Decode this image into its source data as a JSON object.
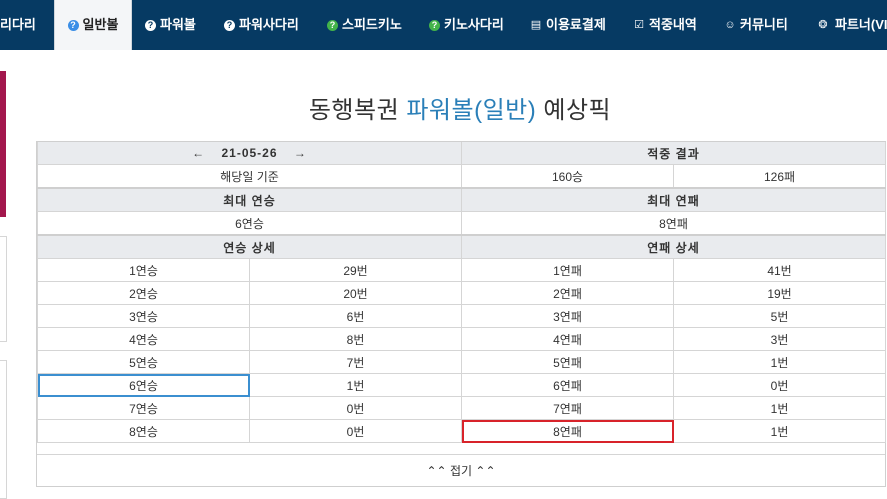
{
  "nav": {
    "items": [
      {
        "label": "리다리",
        "icon": ""
      },
      {
        "label": "일반볼",
        "icon": "question-circle-icon",
        "active": true
      },
      {
        "label": "파워볼",
        "icon": "question-circle-icon"
      },
      {
        "label": "파워사다리",
        "icon": "question-circle-icon"
      },
      {
        "label": "스피드키노",
        "icon": "question-circle-icon"
      },
      {
        "label": "키노사다리",
        "icon": "question-circle-icon"
      },
      {
        "label": "이용료결제",
        "icon": "database-icon"
      },
      {
        "label": "적중내역",
        "icon": "checkbox-icon"
      },
      {
        "label": "커뮤니티",
        "icon": "smile-icon"
      },
      {
        "label": "파트너(VI",
        "icon": "cubes-icon"
      }
    ]
  },
  "title": {
    "prefix": "동행복권 ",
    "accent": "파워볼(일반)",
    "suffix": " 예상픽"
  },
  "summary": {
    "date": "21-05-26",
    "prev_arrow": "←",
    "next_arrow": "→",
    "result_header": "적중 결과",
    "basis": "해당일 기준",
    "wins": "160승",
    "losses": "126패",
    "max_win_header": "최대 연승",
    "max_loss_header": "최대 연패",
    "max_win": "6연승",
    "max_loss": "8연패",
    "win_detail_header": "연승 상세",
    "loss_detail_header": "연패 상세"
  },
  "rows": [
    {
      "win": "1연승",
      "win_count": "29번",
      "loss": "1연패",
      "loss_count": "41번"
    },
    {
      "win": "2연승",
      "win_count": "20번",
      "loss": "2연패",
      "loss_count": "19번"
    },
    {
      "win": "3연승",
      "win_count": "6번",
      "loss": "3연패",
      "loss_count": "5번"
    },
    {
      "win": "4연승",
      "win_count": "8번",
      "loss": "4연패",
      "loss_count": "3번"
    },
    {
      "win": "5연승",
      "win_count": "7번",
      "loss": "5연패",
      "loss_count": "1번"
    },
    {
      "win": "6연승",
      "win_count": "1번",
      "loss": "6연패",
      "loss_count": "0번"
    },
    {
      "win": "7연승",
      "win_count": "0번",
      "loss": "7연패",
      "loss_count": "1번"
    },
    {
      "win": "8연승",
      "win_count": "0번",
      "loss": "8연패",
      "loss_count": "1번"
    }
  ],
  "fold": {
    "label": "접기",
    "icon": "double-up-icon"
  },
  "colors": {
    "nav_bg": "#063a63",
    "accent": "#2a7fb8",
    "left_accent": "#a3174d",
    "highlight_blue": "#3b8fd0",
    "highlight_red": "#d8232a"
  }
}
